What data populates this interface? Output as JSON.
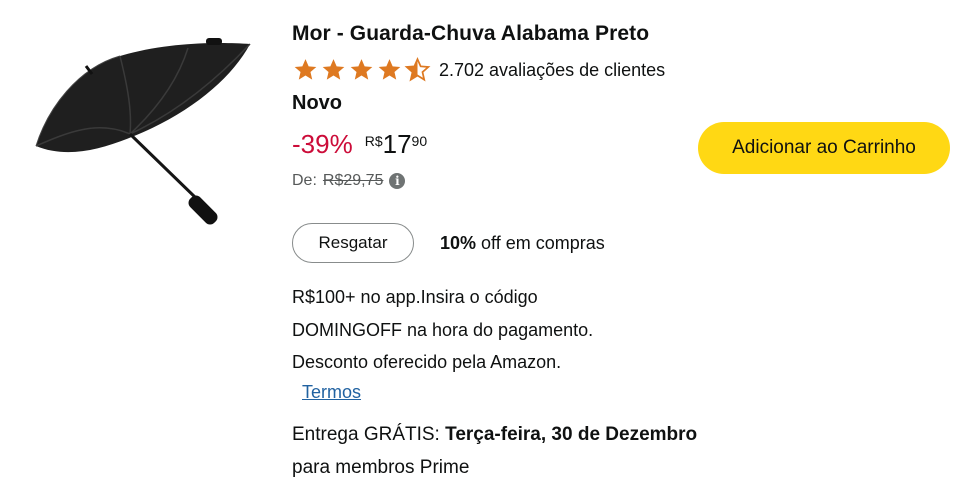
{
  "product": {
    "title": "Mor - Guarda-Chuva Alabama Preto",
    "rating_value": 4.5,
    "reviews": "2.702 avaliações de clientes",
    "condition": "Novo"
  },
  "price": {
    "discount": "-39%",
    "currency": "R$",
    "whole": "17",
    "fraction": "90",
    "list_label": "De:",
    "list_price": "R$29,75"
  },
  "actions": {
    "add_to_cart": "Adicionar ao Carrinho",
    "redeem": "Resgatar",
    "terms": "Termos"
  },
  "coupon": {
    "percent": "10%",
    "suffix": " off em compras"
  },
  "promo": {
    "line1": "R$100+ no app.Insira o código",
    "line2": "DOMINGOFF na hora do pagamento.",
    "line3": "Desconto oferecido pela Amazon."
  },
  "delivery": {
    "prefix": "Entrega GRÁTIS: ",
    "date": "Terça-feira, 30 de Dezembro",
    "suffix": " para membros Prime"
  },
  "colors": {
    "star": "#de7921",
    "discount": "#cc0c39",
    "button": "#ffd814",
    "link": "#2162a1"
  },
  "icons": {
    "rating": "star-icon",
    "info": "info-icon",
    "product": "umbrella-image"
  }
}
